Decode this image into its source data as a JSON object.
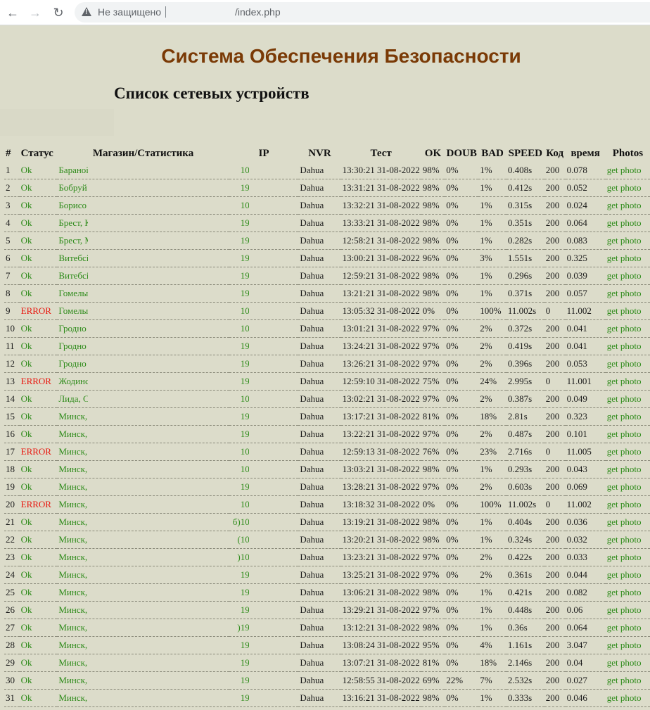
{
  "browser": {
    "security_label": "Не защищено",
    "url": "/index.php"
  },
  "page": {
    "title": "Система Обеспечения Безопасности",
    "subtitle": "Список сетевых устройств"
  },
  "table": {
    "headers": [
      "#",
      "Статус",
      "Магазин/Статистика",
      "IP",
      "NVR",
      "Тест",
      "OK",
      "DOUB",
      "BAD",
      "SPEED",
      "Код",
      "время",
      "Photos"
    ],
    "rows": [
      {
        "num": "1",
        "status": "Ok",
        "shop": "Бараноі",
        "ip_prefix": "",
        "ip": "10",
        "nvr": "Dahua",
        "test": "13:30:21 31-08-2022",
        "ok": "98%",
        "doub": "0%",
        "bad": "1%",
        "speed": "0.408s",
        "code": "200",
        "time": "0.078",
        "photo": "get photo"
      },
      {
        "num": "2",
        "status": "Ok",
        "shop": "Бобруй",
        "ip_prefix": "",
        "ip": "19",
        "nvr": "Dahua",
        "test": "13:31:21 31-08-2022",
        "ok": "98%",
        "doub": "0%",
        "bad": "1%",
        "speed": "0.412s",
        "code": "200",
        "time": "0.052",
        "photo": "get photo"
      },
      {
        "num": "3",
        "status": "Ok",
        "shop": "Борисо",
        "ip_prefix": "",
        "ip": "10",
        "nvr": "Dahua",
        "test": "13:32:21 31-08-2022",
        "ok": "98%",
        "doub": "0%",
        "bad": "1%",
        "speed": "0.315s",
        "code": "200",
        "time": "0.024",
        "photo": "get photo"
      },
      {
        "num": "4",
        "status": "Ok",
        "shop": "Брест, К",
        "ip_prefix": "",
        "ip": "19",
        "nvr": "Dahua",
        "test": "13:33:21 31-08-2022",
        "ok": "98%",
        "doub": "0%",
        "bad": "1%",
        "speed": "0.351s",
        "code": "200",
        "time": "0.064",
        "photo": "get photo"
      },
      {
        "num": "5",
        "status": "Ok",
        "shop": "Брест, М",
        "ip_prefix": "",
        "ip": "19",
        "nvr": "Dahua",
        "test": "12:58:21 31-08-2022",
        "ok": "98%",
        "doub": "0%",
        "bad": "1%",
        "speed": "0.282s",
        "code": "200",
        "time": "0.083",
        "photo": "get photo"
      },
      {
        "num": "6",
        "status": "Ok",
        "shop": "Витебсі",
        "ip_prefix": "",
        "ip": "19",
        "nvr": "Dahua",
        "test": "13:00:21 31-08-2022",
        "ok": "96%",
        "doub": "0%",
        "bad": "3%",
        "speed": "1.551s",
        "code": "200",
        "time": "0.325",
        "photo": "get photo"
      },
      {
        "num": "7",
        "status": "Ok",
        "shop": "Витебсі",
        "ip_prefix": "",
        "ip": "19",
        "nvr": "Dahua",
        "test": "12:59:21 31-08-2022",
        "ok": "98%",
        "doub": "0%",
        "bad": "1%",
        "speed": "0.296s",
        "code": "200",
        "time": "0.039",
        "photo": "get photo"
      },
      {
        "num": "8",
        "status": "Ok",
        "shop": "Гомелы",
        "ip_prefix": "",
        "ip": "19",
        "nvr": "Dahua",
        "test": "13:21:21 31-08-2022",
        "ok": "98%",
        "doub": "0%",
        "bad": "1%",
        "speed": "0.371s",
        "code": "200",
        "time": "0.057",
        "photo": "get photo"
      },
      {
        "num": "9",
        "status": "ERROR",
        "shop": "Гомелы",
        "ip_prefix": "",
        "ip": "10",
        "nvr": "Dahua",
        "test": "13:05:32 31-08-2022",
        "ok": "0%",
        "doub": "0%",
        "bad": "100%",
        "speed": "11.002s",
        "code": "0",
        "time": "11.002",
        "photo": "get photo"
      },
      {
        "num": "10",
        "status": "Ok",
        "shop": "Гродно",
        "ip_prefix": "",
        "ip": "10",
        "nvr": "Dahua",
        "test": "13:01:21 31-08-2022",
        "ok": "97%",
        "doub": "0%",
        "bad": "2%",
        "speed": "0.372s",
        "code": "200",
        "time": "0.041",
        "photo": "get photo"
      },
      {
        "num": "11",
        "status": "Ok",
        "shop": "Гродно",
        "ip_prefix": "",
        "ip": "19",
        "nvr": "Dahua",
        "test": "13:24:21 31-08-2022",
        "ok": "97%",
        "doub": "0%",
        "bad": "2%",
        "speed": "0.419s",
        "code": "200",
        "time": "0.041",
        "photo": "get photo"
      },
      {
        "num": "12",
        "status": "Ok",
        "shop": "Гродно",
        "ip_prefix": "",
        "ip": "19",
        "nvr": "Dahua",
        "test": "13:26:21 31-08-2022",
        "ok": "97%",
        "doub": "0%",
        "bad": "2%",
        "speed": "0.396s",
        "code": "200",
        "time": "0.053",
        "photo": "get photo"
      },
      {
        "num": "13",
        "status": "ERROR",
        "shop": "Жодинс",
        "ip_prefix": "",
        "ip": "19",
        "nvr": "Dahua",
        "test": "12:59:10 31-08-2022",
        "ok": "75%",
        "doub": "0%",
        "bad": "24%",
        "speed": "2.995s",
        "code": "0",
        "time": "11.001",
        "photo": "get photo"
      },
      {
        "num": "14",
        "status": "Ok",
        "shop": "Лида, С",
        "ip_prefix": "",
        "ip": "10",
        "nvr": "Dahua",
        "test": "13:02:21 31-08-2022",
        "ok": "97%",
        "doub": "0%",
        "bad": "2%",
        "speed": "0.387s",
        "code": "200",
        "time": "0.049",
        "photo": "get photo"
      },
      {
        "num": "15",
        "status": "Ok",
        "shop": "Минск,",
        "ip_prefix": "",
        "ip": "19",
        "nvr": "Dahua",
        "test": "13:17:21 31-08-2022",
        "ok": "81%",
        "doub": "0%",
        "bad": "18%",
        "speed": "2.81s",
        "code": "200",
        "time": "0.323",
        "photo": "get photo"
      },
      {
        "num": "16",
        "status": "Ok",
        "shop": "Минск,",
        "ip_prefix": "",
        "ip": "19",
        "nvr": "Dahua",
        "test": "13:22:21 31-08-2022",
        "ok": "97%",
        "doub": "0%",
        "bad": "2%",
        "speed": "0.487s",
        "code": "200",
        "time": "0.101",
        "photo": "get photo"
      },
      {
        "num": "17",
        "status": "ERROR",
        "shop": "Минск,",
        "ip_prefix": "",
        "ip": "10",
        "nvr": "Dahua",
        "test": "12:59:13 31-08-2022",
        "ok": "76%",
        "doub": "0%",
        "bad": "23%",
        "speed": "2.716s",
        "code": "0",
        "time": "11.005",
        "photo": "get photo"
      },
      {
        "num": "18",
        "status": "Ok",
        "shop": "Минск,",
        "ip_prefix": "",
        "ip": "10",
        "nvr": "Dahua",
        "test": "13:03:21 31-08-2022",
        "ok": "98%",
        "doub": "0%",
        "bad": "1%",
        "speed": "0.293s",
        "code": "200",
        "time": "0.043",
        "photo": "get photo"
      },
      {
        "num": "19",
        "status": "Ok",
        "shop": "Минск,",
        "ip_prefix": "",
        "ip": "19",
        "nvr": "Dahua",
        "test": "13:28:21 31-08-2022",
        "ok": "97%",
        "doub": "0%",
        "bad": "2%",
        "speed": "0.603s",
        "code": "200",
        "time": "0.069",
        "photo": "get photo"
      },
      {
        "num": "20",
        "status": "ERROR",
        "shop": "Минск,",
        "ip_prefix": "",
        "ip": "10",
        "nvr": "Dahua",
        "test": "13:18:32 31-08-2022",
        "ok": "0%",
        "doub": "0%",
        "bad": "100%",
        "speed": "11.002s",
        "code": "0",
        "time": "11.002",
        "photo": "get photo"
      },
      {
        "num": "21",
        "status": "Ok",
        "shop": "Минск,",
        "ip_prefix": "б)",
        "ip": "10",
        "nvr": "Dahua",
        "test": "13:19:21 31-08-2022",
        "ok": "98%",
        "doub": "0%",
        "bad": "1%",
        "speed": "0.404s",
        "code": "200",
        "time": "0.036",
        "photo": "get photo"
      },
      {
        "num": "22",
        "status": "Ok",
        "shop": "Минск,",
        "ip_prefix": "(",
        "ip": "10",
        "nvr": "Dahua",
        "test": "13:20:21 31-08-2022",
        "ok": "98%",
        "doub": "0%",
        "bad": "1%",
        "speed": "0.324s",
        "code": "200",
        "time": "0.032",
        "photo": "get photo"
      },
      {
        "num": "23",
        "status": "Ok",
        "shop": "Минск,",
        "ip_prefix": ")",
        "ip": "10",
        "nvr": "Dahua",
        "test": "13:23:21 31-08-2022",
        "ok": "97%",
        "doub": "0%",
        "bad": "2%",
        "speed": "0.422s",
        "code": "200",
        "time": "0.033",
        "photo": "get photo"
      },
      {
        "num": "24",
        "status": "Ok",
        "shop": "Минск,",
        "ip_prefix": "",
        "ip": "19",
        "nvr": "Dahua",
        "test": "13:25:21 31-08-2022",
        "ok": "97%",
        "doub": "0%",
        "bad": "2%",
        "speed": "0.361s",
        "code": "200",
        "time": "0.044",
        "photo": "get photo"
      },
      {
        "num": "25",
        "status": "Ok",
        "shop": "Минск,",
        "ip_prefix": "",
        "ip": "19",
        "nvr": "Dahua",
        "test": "13:06:21 31-08-2022",
        "ok": "98%",
        "doub": "0%",
        "bad": "1%",
        "speed": "0.421s",
        "code": "200",
        "time": "0.082",
        "photo": "get photo"
      },
      {
        "num": "26",
        "status": "Ok",
        "shop": "Минск,",
        "ip_prefix": "",
        "ip": "19",
        "nvr": "Dahua",
        "test": "13:29:21 31-08-2022",
        "ok": "97%",
        "doub": "0%",
        "bad": "1%",
        "speed": "0.448s",
        "code": "200",
        "time": "0.06",
        "photo": "get photo"
      },
      {
        "num": "27",
        "status": "Ok",
        "shop": "Минск,",
        "ip_prefix": ")",
        "ip": "19",
        "nvr": "Dahua",
        "test": "13:12:21 31-08-2022",
        "ok": "98%",
        "doub": "0%",
        "bad": "1%",
        "speed": "0.36s",
        "code": "200",
        "time": "0.064",
        "photo": "get photo"
      },
      {
        "num": "28",
        "status": "Ok",
        "shop": "Минск,",
        "ip_prefix": "",
        "ip": "19",
        "nvr": "Dahua",
        "test": "13:08:24 31-08-2022",
        "ok": "95%",
        "doub": "0%",
        "bad": "4%",
        "speed": "1.161s",
        "code": "200",
        "time": "3.047",
        "photo": "get photo"
      },
      {
        "num": "29",
        "status": "Ok",
        "shop": "Минск,",
        "ip_prefix": "",
        "ip": "19",
        "nvr": "Dahua",
        "test": "13:07:21 31-08-2022",
        "ok": "81%",
        "doub": "0%",
        "bad": "18%",
        "speed": "2.146s",
        "code": "200",
        "time": "0.04",
        "photo": "get photo"
      },
      {
        "num": "30",
        "status": "Ok",
        "shop": "Минск,",
        "ip_prefix": "",
        "ip": "19",
        "nvr": "Dahua",
        "test": "12:58:55 31-08-2022",
        "ok": "69%",
        "doub": "22%",
        "bad": "7%",
        "speed": "2.532s",
        "code": "200",
        "time": "0.027",
        "photo": "get photo"
      },
      {
        "num": "31",
        "status": "Ok",
        "shop": "Минск,",
        "ip_prefix": "",
        "ip": "19",
        "nvr": "Dahua",
        "test": "13:16:21 31-08-2022",
        "ok": "98%",
        "doub": "0%",
        "bad": "1%",
        "speed": "0.333s",
        "code": "200",
        "time": "0.046",
        "photo": "get photo"
      }
    ]
  },
  "colors": {
    "ok": "#2e8b1a",
    "error": "#e8140c",
    "title": "#7a3a06",
    "background": "#dcdcca"
  }
}
